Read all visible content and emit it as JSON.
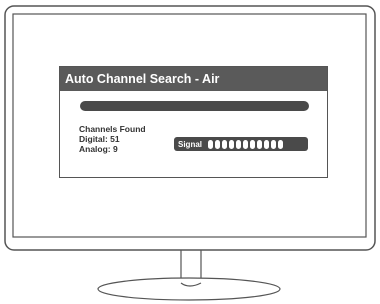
{
  "dialog": {
    "title": "Auto Channel Search - Air",
    "progress": 1.0,
    "channels_found_label": "Channels Found",
    "digital_label": "Digital: 51",
    "analog_label": "Analog: 9",
    "signal_label": "Signal",
    "signal_bars": 11
  }
}
